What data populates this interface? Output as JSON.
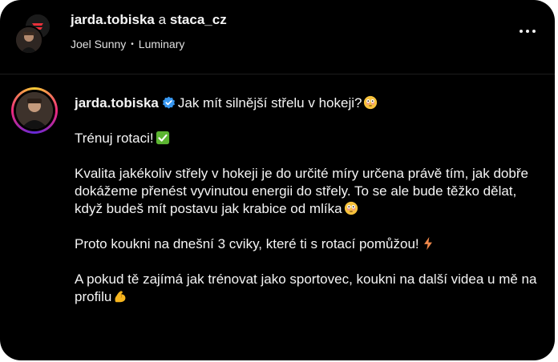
{
  "header": {
    "user1": "jarda.tobiska",
    "connector": "a",
    "user2": "staca_cz",
    "music_artist": "Joel Sunny",
    "music_track": "Luminary"
  },
  "post": {
    "author": "jarda.tobiska",
    "first_line": "Jak mít silnější střelu v hokeji?",
    "para1": "Trénuj rotaci!",
    "para2": "Kvalita jakékoliv střely v hokeji je do určité míry určena právě tím, jak dobře dokážeme přenést vyvinutou energii do střely. To se ale bude těžko dělat, když budeš mít postavu jak krabice od mlíka",
    "para3": "Proto koukni na dnešní 3 cviky, které ti s rotací pomůžou!",
    "para4": "A pokud tě zajímá jak trénovat jako sportovec, koukni na další videa u mě na profilu"
  },
  "icons": {
    "verified": "verified-badge-icon",
    "flushed": "flushed-face-emoji",
    "check": "check-mark-button-emoji",
    "lightning": "high-voltage-emoji",
    "muscle": "flexed-biceps-emoji",
    "more": "more-options-icon"
  },
  "colors": {
    "background": "#000000",
    "text": "#f5f5f5",
    "verified": "#3897f0",
    "check": "#5cb531",
    "lightning": "#f0884a",
    "muscle": "#f6b51e"
  }
}
